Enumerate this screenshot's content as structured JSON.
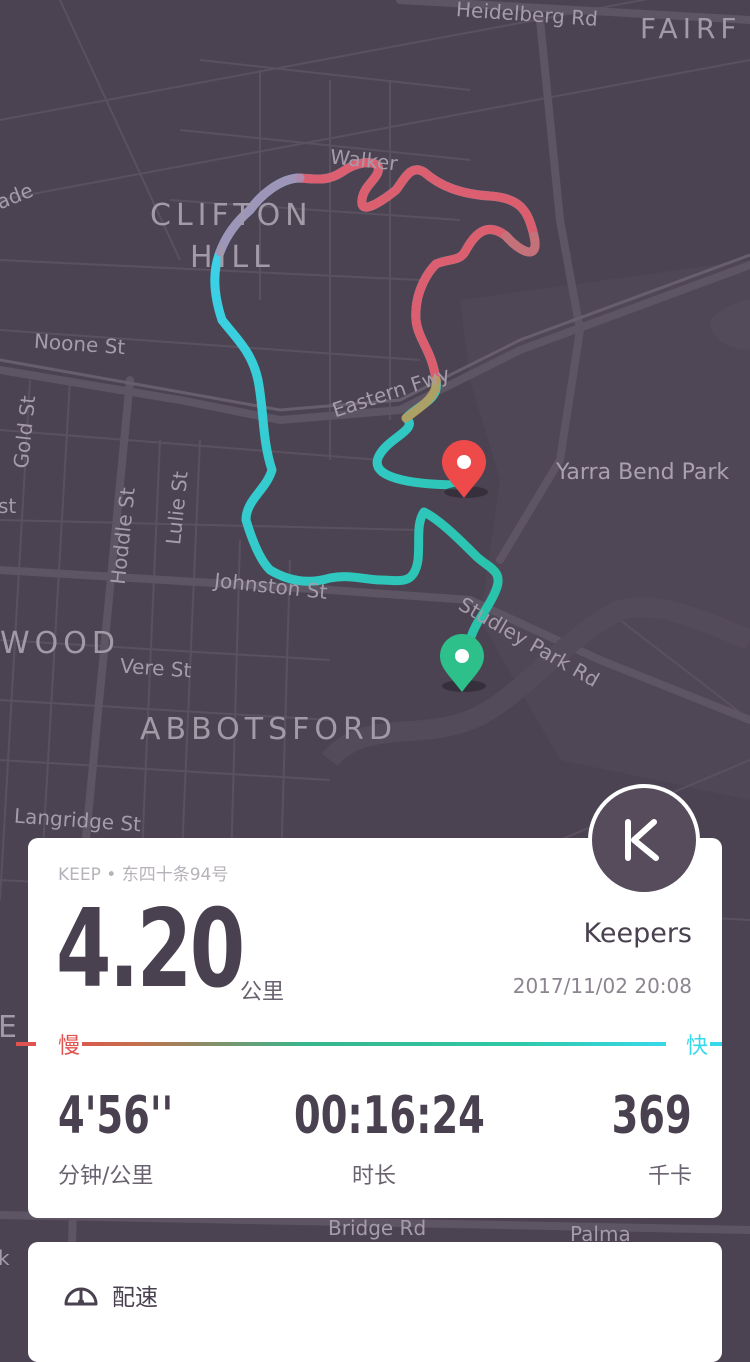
{
  "map": {
    "labels": {
      "heidelberg_rd": "Heidelberg Rd",
      "fairfield": "FAIRF",
      "walker": "Walker",
      "ade": "ade",
      "clifton": "CLIFTON",
      "hill": "HILL",
      "noone_st": "Noone St",
      "eastern_fwy": "Eastern Fwy",
      "gold_st": "Gold St",
      "hoddle_st": "Hoddle St",
      "lulie_st": "Lulie St",
      "yarra_bend_park": "Yarra Bend Park",
      "johnston_st": "Johnston St",
      "studley_park_rd": "Studley Park Rd",
      "wood": "WOOD",
      "vere_st": "Vere St",
      "abbotsford": "ABBOTSFORD",
      "langridge_st": "Langridge St",
      "bridge_rd": "Bridge Rd",
      "palma": "Palma",
      "st_left": "st",
      "k_left": "k",
      "e_left": "E"
    },
    "start_pin_color": "#2ec08a",
    "end_pin_color": "#ee4a4a"
  },
  "summary": {
    "source": "KEEP • 东四十条94号",
    "distance": "4.20",
    "distance_unit": "公里",
    "user": "Keepers",
    "datetime": "2017/11/02 20:08",
    "slow_label": "慢",
    "fast_label": "快",
    "pace_value": "4'56''",
    "pace_label": "分钟/公里",
    "duration_value": "00:16:24",
    "duration_label": "时长",
    "calories_value": "369",
    "calories_label": "千卡",
    "badge_logo": "keep-logo-icon"
  },
  "pace_section": {
    "label": "配速",
    "icon": "speedometer-icon"
  },
  "colors": {
    "slow": "#e0534f",
    "fast": "#37d9ea",
    "map_bg": "#4b4352",
    "text_dark": "#4a4150"
  }
}
